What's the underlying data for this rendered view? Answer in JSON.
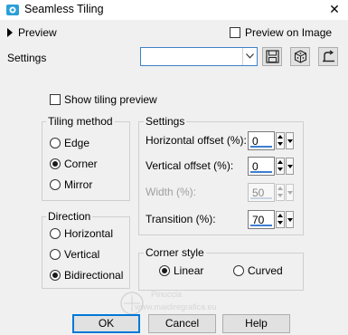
{
  "window": {
    "title": "Seamless Tiling",
    "close_glyph": "✕"
  },
  "top": {
    "preview_label": "Preview",
    "preview_on_image_label": "Preview on Image",
    "preview_on_image_checked": false,
    "settings_label": "Settings",
    "settings_value": ""
  },
  "toolbar_icons": [
    "save-icon",
    "dice-icon",
    "reset-icon"
  ],
  "show_tiling_preview": {
    "label": "Show tiling preview",
    "checked": false
  },
  "tiling_method": {
    "title": "Tiling method",
    "options": [
      "Edge",
      "Corner",
      "Mirror"
    ],
    "selected": "Corner"
  },
  "direction": {
    "title": "Direction",
    "options": [
      "Horizontal",
      "Vertical",
      "Bidirectional"
    ],
    "selected": "Bidirectional"
  },
  "settings": {
    "title": "Settings",
    "horizontal_offset": {
      "label": "Horizontal offset (%):",
      "value": "0"
    },
    "vertical_offset": {
      "label": "Vertical offset (%):",
      "value": "0"
    },
    "width": {
      "label": "Width (%):",
      "value": "50",
      "disabled": true
    },
    "transition": {
      "label": "Transition (%):",
      "value": "70"
    }
  },
  "corner_style": {
    "title": "Corner style",
    "options": [
      "Linear",
      "Curved"
    ],
    "selected": "Linear"
  },
  "buttons": {
    "ok": "OK",
    "cancel": "Cancel",
    "help": "Help"
  },
  "watermark": {
    "line1": "Pinuccia",
    "line2": "www.maidiregrafica.eu"
  },
  "colors": {
    "accent": "#0078d7",
    "field_underline": "#3d7fd0",
    "window_bg": "#f0f0f0"
  }
}
